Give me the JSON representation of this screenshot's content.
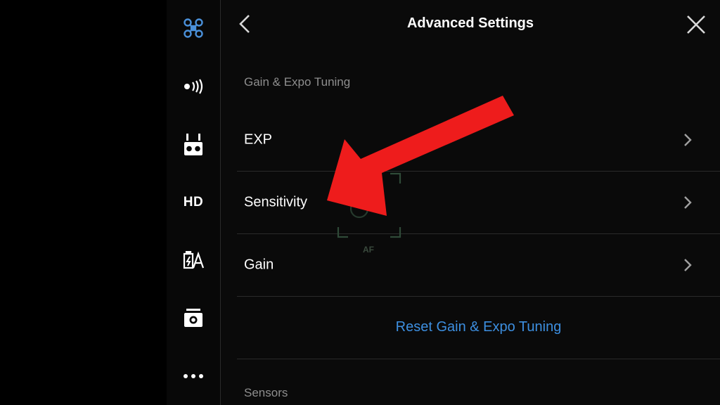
{
  "sidebar": {
    "items": [
      {
        "name": "aircraft",
        "icon": "drone-icon",
        "active": true,
        "color": "#4a90d9"
      },
      {
        "name": "signal",
        "icon": "signal-icon"
      },
      {
        "name": "remote",
        "icon": "remote-controller-icon"
      },
      {
        "name": "hd",
        "icon": "hd-icon",
        "label": "HD"
      },
      {
        "name": "battery",
        "icon": "battery-icon"
      },
      {
        "name": "camera",
        "icon": "camera-icon"
      },
      {
        "name": "more",
        "icon": "more-icon"
      }
    ]
  },
  "header": {
    "title": "Advanced Settings",
    "back_icon": "chevron-left-icon",
    "close_icon": "close-icon"
  },
  "sections": {
    "gain_expo": "Gain & Expo Tuning",
    "sensors": "Sensors"
  },
  "rows": [
    {
      "label": "EXP"
    },
    {
      "label": "Sensitivity"
    },
    {
      "label": "Gain"
    }
  ],
  "reset_label": "Reset Gain & Expo Tuning",
  "overlay": {
    "af_label": "AF",
    "arrow_color": "#ee1c1c"
  },
  "colors": {
    "accent": "#3d8fe0",
    "active_icon": "#4a90d9",
    "arrow": "#ee1c1c"
  }
}
